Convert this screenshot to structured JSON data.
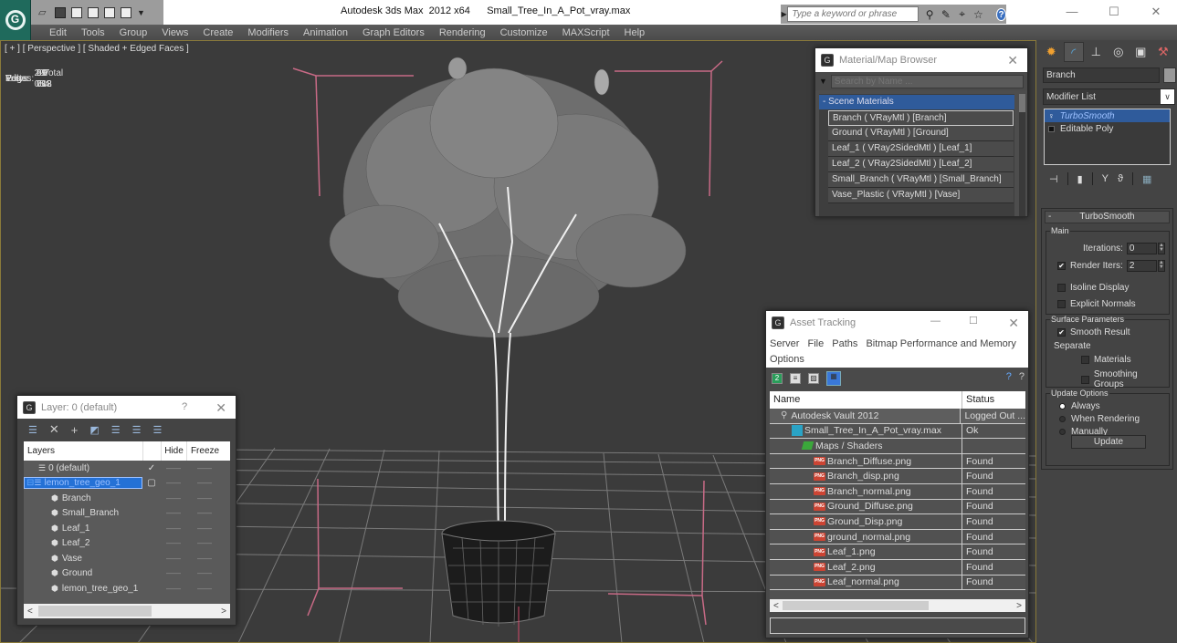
{
  "app": {
    "window_title": "Autodesk 3ds Max  2012 x64      Small_Tree_In_A_Pot_vray.max",
    "search_placeholder": "Type a keyword or phrase",
    "help_label": "?"
  },
  "quick_access": [
    "open-file-icon",
    "save-file-icon",
    "new-file-icon",
    "reference-icon",
    "undo-icon",
    "redo-icon",
    "dropdown-icon"
  ],
  "menu": [
    "Edit",
    "Tools",
    "Group",
    "Views",
    "Create",
    "Modifiers",
    "Animation",
    "Graph Editors",
    "Rendering",
    "Customize",
    "MAXScript",
    "Help"
  ],
  "viewport": {
    "label": "[ + ] [ Perspective ] [ Shaded + Edged Faces ]",
    "stats": {
      "header": "Total",
      "rows": [
        {
          "label": "Polys:",
          "value": "99 018"
        },
        {
          "label": "Tris:",
          "value": "99 018"
        },
        {
          "label": "Edges:",
          "value": "297 054"
        },
        {
          "label": "Verts:",
          "value": "61 702"
        }
      ]
    }
  },
  "material_browser": {
    "title": "Material/Map Browser",
    "search_placeholder": "Search by Name ...",
    "group": "- Scene Materials",
    "items": [
      "Branch  ( VRayMtl ) [Branch]",
      "Ground  ( VRayMtl ) [Ground]",
      "Leaf_1  ( VRay2SidedMtl ) [Leaf_1]",
      "Leaf_2  ( VRay2SidedMtl ) [Leaf_2]",
      "Small_Branch  ( VRayMtl ) [Small_Branch]",
      "Vase_Plastic  ( VRayMtl ) [Vase]"
    ],
    "selected_index": 0
  },
  "command_panel": {
    "object_name": "Branch",
    "modifier_list": "Modifier List",
    "stack": [
      "TurboSmooth",
      "Editable Poly"
    ],
    "turbosmooth": {
      "title": "TurboSmooth",
      "main_label": "Main",
      "iterations_label": "Iterations:",
      "iterations_value": "0",
      "render_iters_label": "Render Iters:",
      "render_iters_value": "2",
      "render_iters_checked": true,
      "isoline_label": "Isoline Display",
      "explicit_normals_label": "Explicit Normals",
      "surface_label": "Surface Parameters",
      "smooth_result_label": "Smooth Result",
      "separate_label": "Separate",
      "materials_label": "Materials",
      "smoothing_groups_label": "Smoothing Groups",
      "update_options_label": "Update Options",
      "always_label": "Always",
      "when_rendering_label": "When Rendering",
      "manually_label": "Manually",
      "update_button": "Update"
    }
  },
  "asset_tracking": {
    "title": "Asset Tracking",
    "menu": [
      "Server",
      "File",
      "Paths",
      "Bitmap Performance and Memory",
      "Options"
    ],
    "columns": [
      "Name",
      "Status"
    ],
    "rows": [
      {
        "name": "Autodesk Vault 2012",
        "status": "Logged Out ...",
        "type": "vault",
        "indent": 1
      },
      {
        "name": "Small_Tree_In_A_Pot_vray.max",
        "status": "Ok",
        "type": "max",
        "indent": 2
      },
      {
        "name": "Maps / Shaders",
        "status": "",
        "type": "maps",
        "indent": 3
      },
      {
        "name": "Branch_Diffuse.png",
        "status": "Found",
        "type": "png",
        "indent": 4
      },
      {
        "name": "Branch_disp.png",
        "status": "Found",
        "type": "png",
        "indent": 4
      },
      {
        "name": "Branch_normal.png",
        "status": "Found",
        "type": "png",
        "indent": 4
      },
      {
        "name": "Ground_Diffuse.png",
        "status": "Found",
        "type": "png",
        "indent": 4
      },
      {
        "name": "Ground_Disp.png",
        "status": "Found",
        "type": "png",
        "indent": 4
      },
      {
        "name": "ground_normal.png",
        "status": "Found",
        "type": "png",
        "indent": 4
      },
      {
        "name": "Leaf_1.png",
        "status": "Found",
        "type": "png",
        "indent": 4
      },
      {
        "name": "Leaf_2.png",
        "status": "Found",
        "type": "png",
        "indent": 4
      },
      {
        "name": "Leaf_normal.png",
        "status": "Found",
        "type": "png",
        "indent": 4
      }
    ]
  },
  "layer_manager": {
    "title": "Layer: 0 (default)",
    "help": "?",
    "columns": [
      "Layers",
      "",
      "Hide",
      "Freeze"
    ],
    "rows": [
      {
        "name": "0 (default)",
        "type": "layer",
        "indent": 1,
        "check": "✓"
      },
      {
        "name": "lemon_tree_geo_1",
        "type": "layer",
        "indent": 0,
        "check": "▢",
        "selected": true
      },
      {
        "name": "Branch",
        "type": "object",
        "indent": 2
      },
      {
        "name": "Small_Branch",
        "type": "object",
        "indent": 2
      },
      {
        "name": "Leaf_1",
        "type": "object",
        "indent": 2
      },
      {
        "name": "Leaf_2",
        "type": "object",
        "indent": 2
      },
      {
        "name": "Vase",
        "type": "object",
        "indent": 2
      },
      {
        "name": "Ground",
        "type": "object",
        "indent": 2
      },
      {
        "name": "lemon_tree_geo_1",
        "type": "object",
        "indent": 2
      }
    ]
  }
}
